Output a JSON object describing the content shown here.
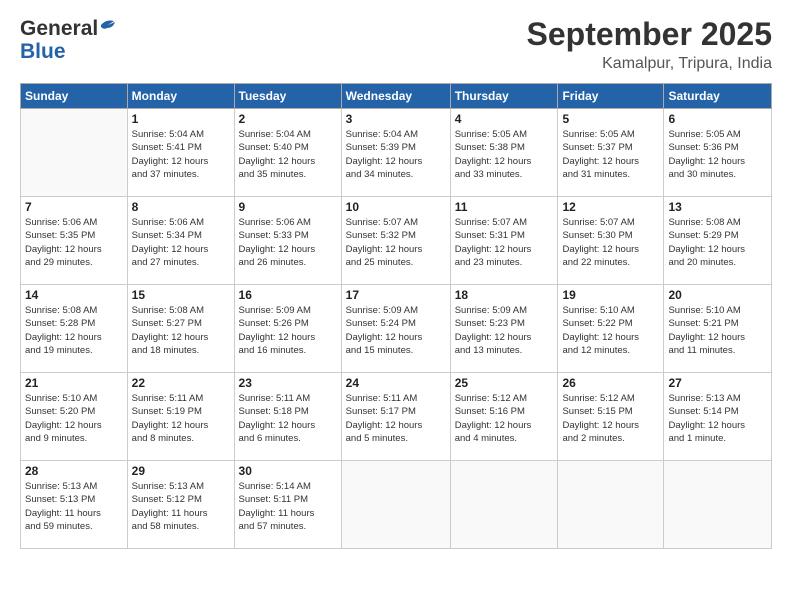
{
  "header": {
    "logo_general": "General",
    "logo_blue": "Blue",
    "month": "September 2025",
    "location": "Kamalpur, Tripura, India"
  },
  "days_of_week": [
    "Sunday",
    "Monday",
    "Tuesday",
    "Wednesday",
    "Thursday",
    "Friday",
    "Saturday"
  ],
  "weeks": [
    [
      {
        "day": "",
        "info": ""
      },
      {
        "day": "1",
        "info": "Sunrise: 5:04 AM\nSunset: 5:41 PM\nDaylight: 12 hours\nand 37 minutes."
      },
      {
        "day": "2",
        "info": "Sunrise: 5:04 AM\nSunset: 5:40 PM\nDaylight: 12 hours\nand 35 minutes."
      },
      {
        "day": "3",
        "info": "Sunrise: 5:04 AM\nSunset: 5:39 PM\nDaylight: 12 hours\nand 34 minutes."
      },
      {
        "day": "4",
        "info": "Sunrise: 5:05 AM\nSunset: 5:38 PM\nDaylight: 12 hours\nand 33 minutes."
      },
      {
        "day": "5",
        "info": "Sunrise: 5:05 AM\nSunset: 5:37 PM\nDaylight: 12 hours\nand 31 minutes."
      },
      {
        "day": "6",
        "info": "Sunrise: 5:05 AM\nSunset: 5:36 PM\nDaylight: 12 hours\nand 30 minutes."
      }
    ],
    [
      {
        "day": "7",
        "info": "Sunrise: 5:06 AM\nSunset: 5:35 PM\nDaylight: 12 hours\nand 29 minutes."
      },
      {
        "day": "8",
        "info": "Sunrise: 5:06 AM\nSunset: 5:34 PM\nDaylight: 12 hours\nand 27 minutes."
      },
      {
        "day": "9",
        "info": "Sunrise: 5:06 AM\nSunset: 5:33 PM\nDaylight: 12 hours\nand 26 minutes."
      },
      {
        "day": "10",
        "info": "Sunrise: 5:07 AM\nSunset: 5:32 PM\nDaylight: 12 hours\nand 25 minutes."
      },
      {
        "day": "11",
        "info": "Sunrise: 5:07 AM\nSunset: 5:31 PM\nDaylight: 12 hours\nand 23 minutes."
      },
      {
        "day": "12",
        "info": "Sunrise: 5:07 AM\nSunset: 5:30 PM\nDaylight: 12 hours\nand 22 minutes."
      },
      {
        "day": "13",
        "info": "Sunrise: 5:08 AM\nSunset: 5:29 PM\nDaylight: 12 hours\nand 20 minutes."
      }
    ],
    [
      {
        "day": "14",
        "info": "Sunrise: 5:08 AM\nSunset: 5:28 PM\nDaylight: 12 hours\nand 19 minutes."
      },
      {
        "day": "15",
        "info": "Sunrise: 5:08 AM\nSunset: 5:27 PM\nDaylight: 12 hours\nand 18 minutes."
      },
      {
        "day": "16",
        "info": "Sunrise: 5:09 AM\nSunset: 5:26 PM\nDaylight: 12 hours\nand 16 minutes."
      },
      {
        "day": "17",
        "info": "Sunrise: 5:09 AM\nSunset: 5:24 PM\nDaylight: 12 hours\nand 15 minutes."
      },
      {
        "day": "18",
        "info": "Sunrise: 5:09 AM\nSunset: 5:23 PM\nDaylight: 12 hours\nand 13 minutes."
      },
      {
        "day": "19",
        "info": "Sunrise: 5:10 AM\nSunset: 5:22 PM\nDaylight: 12 hours\nand 12 minutes."
      },
      {
        "day": "20",
        "info": "Sunrise: 5:10 AM\nSunset: 5:21 PM\nDaylight: 12 hours\nand 11 minutes."
      }
    ],
    [
      {
        "day": "21",
        "info": "Sunrise: 5:10 AM\nSunset: 5:20 PM\nDaylight: 12 hours\nand 9 minutes."
      },
      {
        "day": "22",
        "info": "Sunrise: 5:11 AM\nSunset: 5:19 PM\nDaylight: 12 hours\nand 8 minutes."
      },
      {
        "day": "23",
        "info": "Sunrise: 5:11 AM\nSunset: 5:18 PM\nDaylight: 12 hours\nand 6 minutes."
      },
      {
        "day": "24",
        "info": "Sunrise: 5:11 AM\nSunset: 5:17 PM\nDaylight: 12 hours\nand 5 minutes."
      },
      {
        "day": "25",
        "info": "Sunrise: 5:12 AM\nSunset: 5:16 PM\nDaylight: 12 hours\nand 4 minutes."
      },
      {
        "day": "26",
        "info": "Sunrise: 5:12 AM\nSunset: 5:15 PM\nDaylight: 12 hours\nand 2 minutes."
      },
      {
        "day": "27",
        "info": "Sunrise: 5:13 AM\nSunset: 5:14 PM\nDaylight: 12 hours\nand 1 minute."
      }
    ],
    [
      {
        "day": "28",
        "info": "Sunrise: 5:13 AM\nSunset: 5:13 PM\nDaylight: 11 hours\nand 59 minutes."
      },
      {
        "day": "29",
        "info": "Sunrise: 5:13 AM\nSunset: 5:12 PM\nDaylight: 11 hours\nand 58 minutes."
      },
      {
        "day": "30",
        "info": "Sunrise: 5:14 AM\nSunset: 5:11 PM\nDaylight: 11 hours\nand 57 minutes."
      },
      {
        "day": "",
        "info": ""
      },
      {
        "day": "",
        "info": ""
      },
      {
        "day": "",
        "info": ""
      },
      {
        "day": "",
        "info": ""
      }
    ]
  ]
}
